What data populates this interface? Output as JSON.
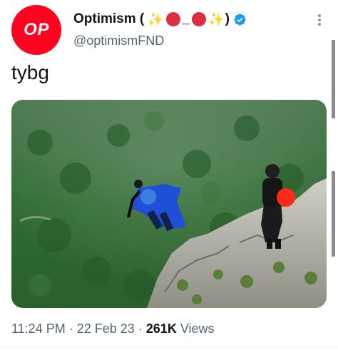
{
  "author": {
    "avatar_text": "OP",
    "display_name": "Optimism (",
    "name_suffix_open": "",
    "underscore": "_",
    "name_close": ")",
    "handle": "@optimismFND",
    "verified": true,
    "brand_color": "#ff0420"
  },
  "icons": {
    "sparkle": "✨",
    "red_circle": "red-circle-emoji",
    "verified": "verified-badge-icon",
    "more": "more-options-icon"
  },
  "tweet": {
    "text": "tybg",
    "image_description_icon": "wingsuit-photo"
  },
  "meta": {
    "time": "11:24 PM",
    "sep1": " · ",
    "date": "22 Feb 23",
    "sep2": " · ",
    "views": "261K",
    "views_label": " Views"
  },
  "colors": {
    "text_primary": "#0f1419",
    "text_secondary": "#536471",
    "verified_blue": "#1d9bf0",
    "wingsuit_blue": "#1f4fd6",
    "red_balloon": "#ff0420"
  }
}
